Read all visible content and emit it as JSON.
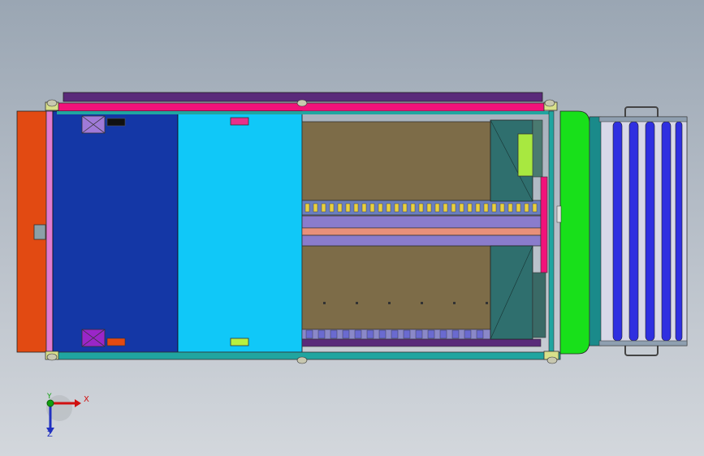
{
  "viewport": {
    "background_top": "#9aa6b3",
    "background_bottom": "#d3d7dc"
  },
  "model": {
    "orange_end_panel": "#e24a12",
    "blue_panel": "#1437a6",
    "cyan_panel": "#10c8f8",
    "floor_panel": "#7d6c48",
    "pink_rail": "#f2127a",
    "purple_rail": "#5a2a7a",
    "teal_frame": "#20a5a0",
    "green_guard": "#18e01a",
    "conveyor_roller": "#2f2fe0",
    "dark_teal_block": "#2f6f6e"
  },
  "triad": {
    "x_label": "X",
    "y_label": "Y",
    "z_label": "Z",
    "x_color": "#d01010",
    "y_color": "#10a010",
    "z_color": "#2030c0"
  }
}
